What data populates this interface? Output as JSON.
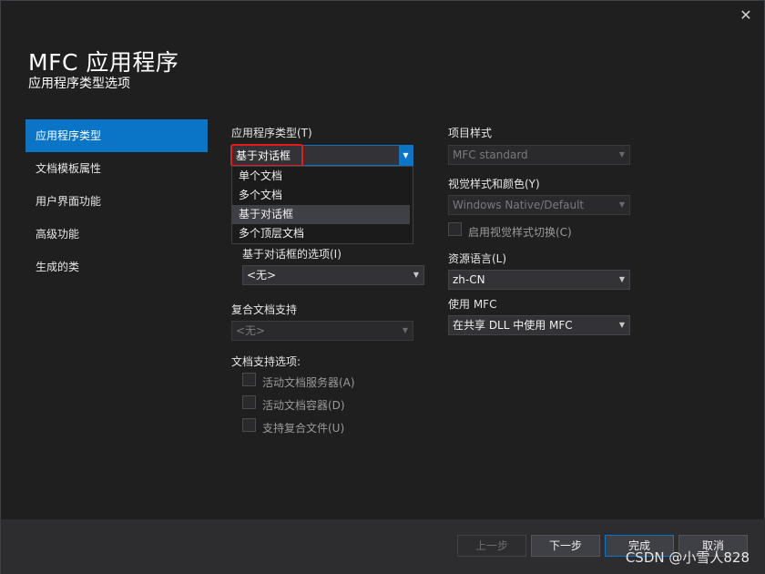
{
  "window": {
    "close_glyph": "✕"
  },
  "header": {
    "title": "MFC 应用程序",
    "subtitle": "应用程序类型选项"
  },
  "sidebar": {
    "items": [
      {
        "label": "应用程序类型",
        "active": true
      },
      {
        "label": "文档模板属性"
      },
      {
        "label": "用户界面功能"
      },
      {
        "label": "高级功能"
      },
      {
        "label": "生成的类"
      }
    ]
  },
  "app_type": {
    "label": "应用程序类型(T)",
    "value": "基于对话框",
    "options": [
      "单个文档",
      "多个文档",
      "基于对话框",
      "多个顶层文档"
    ]
  },
  "dialog_options": {
    "label": "基于对话框的选项(I)",
    "value": "<无>"
  },
  "compound": {
    "label": "复合文档支持",
    "value": "<无>"
  },
  "doc_support": {
    "label": "文档支持选项:",
    "checkboxes": [
      "活动文档服务器(A)",
      "活动文档容器(D)",
      "支持复合文件(U)"
    ]
  },
  "project_style": {
    "label": "项目样式",
    "value": "MFC standard"
  },
  "visual_style": {
    "label": "视觉样式和颜色(Y)",
    "value": "Windows Native/Default",
    "toggle_label": "启用视觉样式切换(C)"
  },
  "resource_lang": {
    "label": "资源语言(L)",
    "value": "zh-CN"
  },
  "use_mfc": {
    "label": "使用 MFC",
    "value": "在共享 DLL 中使用 MFC"
  },
  "footer": {
    "prev": "上一步",
    "next": "下一步",
    "finish": "完成",
    "cancel": "取消"
  },
  "watermark": "CSDN @小雪人828",
  "colors": {
    "accent": "#0a74c7",
    "highlight": "#e51b1b",
    "background": "#1f1f1f"
  }
}
